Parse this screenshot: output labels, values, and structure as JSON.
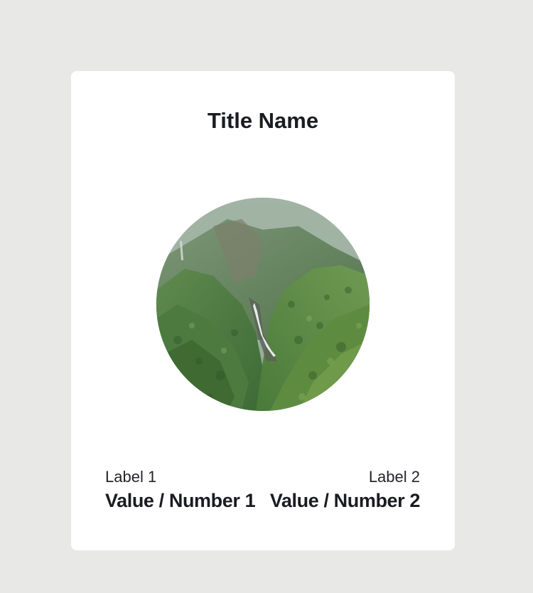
{
  "card": {
    "title": "Title Name",
    "image_alt": "Green mountain valley with waterfall",
    "stats": [
      {
        "label": "Label 1",
        "value": "Value / Number 1"
      },
      {
        "label": "Label 2",
        "value": "Value / Number 2"
      }
    ]
  },
  "colors": {
    "background": "#e8e8e6",
    "card": "#ffffff",
    "text": "#1b1c22"
  }
}
